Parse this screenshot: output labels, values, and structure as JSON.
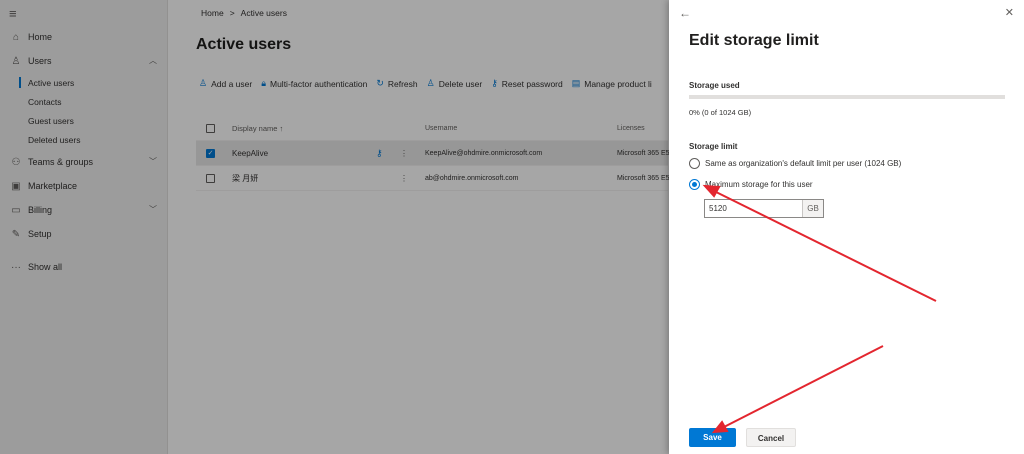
{
  "nav": {
    "items": [
      {
        "icon": "home-icon",
        "glyph": "⌂",
        "label": "Home"
      },
      {
        "icon": "person-icon",
        "glyph": "♙",
        "label": "Users"
      },
      {
        "icon": "teams-icon",
        "glyph": "⚇",
        "label": "Teams & groups"
      },
      {
        "icon": "marketplace-icon",
        "glyph": "▣",
        "label": "Marketplace"
      },
      {
        "icon": "billing-icon",
        "glyph": "▭",
        "label": "Billing"
      },
      {
        "icon": "wrench-icon",
        "glyph": "✎",
        "label": "Setup"
      },
      {
        "icon": "more-icon",
        "glyph": "···",
        "label": "Show all"
      }
    ],
    "users_sub": [
      "Active users",
      "Contacts",
      "Guest users",
      "Deleted users"
    ]
  },
  "breadcrumb": {
    "home": "Home",
    "sep": ">",
    "current": "Active users"
  },
  "page_title": "Active users",
  "commands": [
    {
      "icon": "add-user-icon",
      "glyph": "♙",
      "label": "Add a user"
    },
    {
      "icon": "lock-icon",
      "glyph": "🔒︎",
      "label": "Multi-factor authentication"
    },
    {
      "icon": "refresh-icon",
      "glyph": "↻",
      "label": "Refresh"
    },
    {
      "icon": "delete-user-icon",
      "glyph": "♙",
      "label": "Delete user"
    },
    {
      "icon": "key-icon",
      "glyph": "⚷",
      "label": "Reset password"
    },
    {
      "icon": "license-icon",
      "glyph": "▤",
      "label": "Manage product li"
    }
  ],
  "table": {
    "headers": {
      "name": "Display name ↑",
      "username": "Username",
      "licenses": "Licenses"
    },
    "rows": [
      {
        "name": "KeepAlive",
        "username": "KeepAlive@ohdmire.onmicrosoft.com",
        "licenses": "Microsoft 365 E5",
        "selected": true
      },
      {
        "name": "梁 月妍",
        "username": "ab@ohdmire.onmicrosoft.com",
        "licenses": "Microsoft 365 E5",
        "selected": false
      }
    ]
  },
  "panel": {
    "title": "Edit storage limit",
    "storage_used_label": "Storage used",
    "storage_used_text": "0% (0 of 1024 GB)",
    "storage_used_fraction": 0,
    "storage_limit_label": "Storage limit",
    "option_default": "Same as organization's default limit per user (1024 GB)",
    "option_max": "Maximum storage for this user",
    "max_value": "5120",
    "max_unit": "GB",
    "save_label": "Save",
    "cancel_label": "Cancel"
  },
  "colors": {
    "accent": "#0078d4",
    "annotation": "#e3262f"
  }
}
